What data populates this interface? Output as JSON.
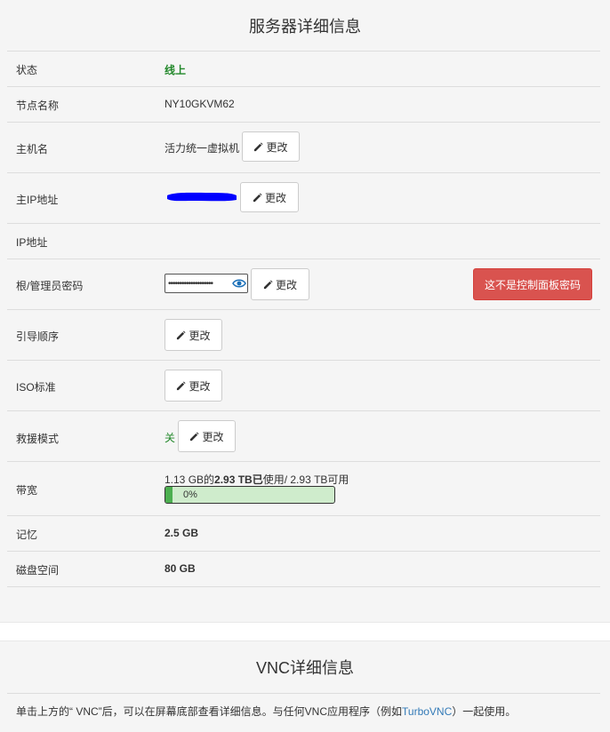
{
  "server": {
    "title": "服务器详细信息",
    "change_label": "更改",
    "rows": {
      "status": {
        "label": "状态",
        "value": "线上"
      },
      "node": {
        "label": "节点名称",
        "value": "NY10GKVM62"
      },
      "hostname": {
        "label": "主机名",
        "value": "活力统一虚拟机"
      },
      "main_ip": {
        "label": "主IP地址"
      },
      "ip": {
        "label": "IP地址"
      },
      "password": {
        "label": "根/管理员密码",
        "masked": "••••••••••••••••••••",
        "warning_button": "这不是控制面板密码"
      },
      "boot": {
        "label": "引导顺序"
      },
      "iso": {
        "label": "ISO标准"
      },
      "rescue": {
        "label": "救援模式",
        "value": "关"
      },
      "bandwidth": {
        "label": "带宽",
        "used": "1.13 GB的",
        "total_bold": "2.93 TB已",
        "rest": "使用/ 2.93 TB可用",
        "percent": 0,
        "percent_text": "0%"
      },
      "memory": {
        "label": "记忆",
        "value": "2.5 GB"
      },
      "disk": {
        "label": "磁盘空间",
        "value": "80 GB"
      }
    }
  },
  "vnc": {
    "title": "VNC详细信息",
    "text_before": "单击上方的“ VNC”后，可以在屏幕底部查看详细信息。与任何VNC应用程序（例如",
    "link": "TurboVNC",
    "text_after": "）一起使用。"
  },
  "colors": {
    "online": "#22882a",
    "danger": "#d9534f",
    "link": "#337ab7",
    "redaction": "#0000ff",
    "progress_fill": "#4caf50",
    "progress_bg": "#cfeccc"
  },
  "icons": {
    "pencil": "pencil-icon",
    "eye": "eye-icon"
  }
}
